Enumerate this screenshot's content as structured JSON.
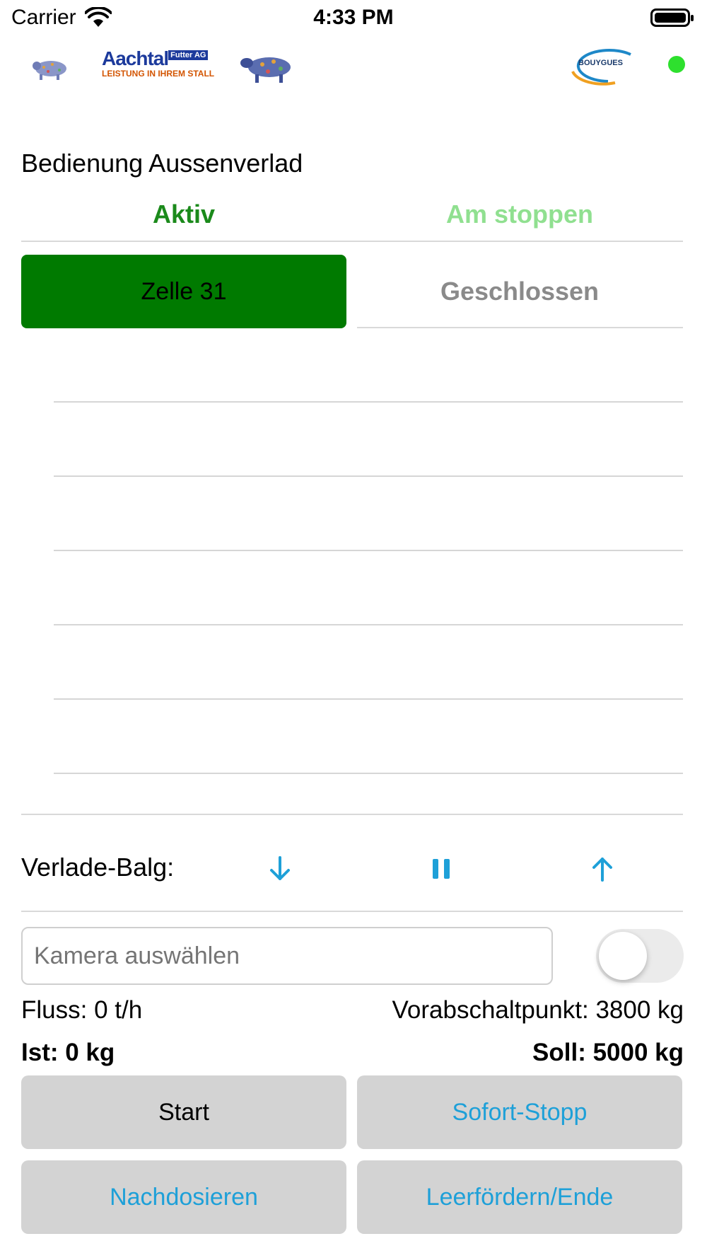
{
  "status_bar": {
    "carrier": "Carrier",
    "time": "4:33 PM"
  },
  "logos": {
    "aachtal_name": "Aachtal",
    "aachtal_badge": "Futter AG",
    "aachtal_tagline": "LEISTUNG IN IHREM STALL",
    "bouygues_name": "BOUYGUES"
  },
  "connection_status_color": "#2ee02e",
  "page": {
    "title": "Bedienung Aussenverlad"
  },
  "state": {
    "left_label": "Aktiv",
    "left_color": "#1b8a1b",
    "right_label": "Am stoppen",
    "right_color": "#90e090"
  },
  "selection": {
    "active_label": "Zelle 31",
    "inactive_label": "Geschlossen",
    "active_color": "#007a00"
  },
  "list": {
    "rows": [
      "",
      "",
      "",
      "",
      "",
      ""
    ]
  },
  "balg": {
    "label": "Verlade-Balg:",
    "buttons": [
      "arrow-down-icon",
      "pause-icon",
      "arrow-up-icon"
    ],
    "icon_color": "#1ea0d8"
  },
  "camera": {
    "placeholder": "Kamera auswählen",
    "toggle_on": false
  },
  "readouts": {
    "flow": "Fluss: 0 t/h",
    "cutoff": "Vorabschaltpunkt: 3800 kg",
    "actual": "Ist: 0 kg",
    "target": "Soll: 5000 kg"
  },
  "actions": {
    "start": "Start",
    "stop": "Sofort-Stopp",
    "redose": "Nachdosieren",
    "empty_end": "Leerfördern/Ende",
    "primary_text_color": "#000000",
    "secondary_text_color": "#1ea0d8"
  }
}
